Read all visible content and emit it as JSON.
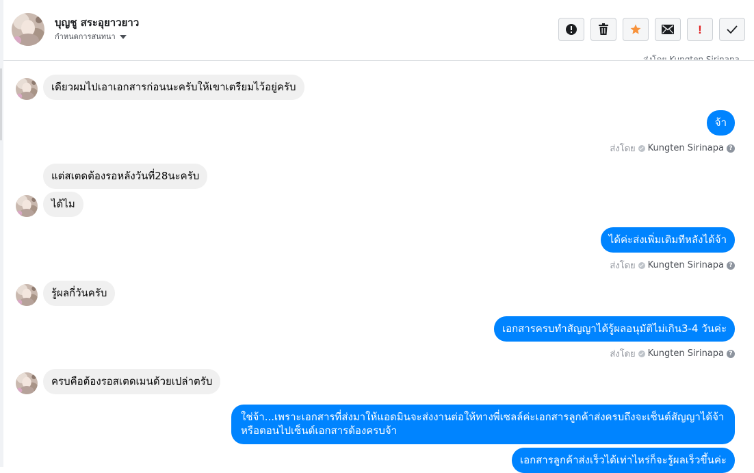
{
  "header": {
    "contact_name": "บุญชู สระอุยาวยาว",
    "subtitle": "กำหนดการสนทนา",
    "avatar_icon": "user-avatar",
    "actions": [
      {
        "name": "report-button",
        "icon": "exclamation-circle-icon"
      },
      {
        "name": "delete-button",
        "icon": "trash-icon"
      },
      {
        "name": "star-button",
        "icon": "star-icon"
      },
      {
        "name": "mark-unread-button",
        "icon": "envelope-icon"
      },
      {
        "name": "important-button",
        "icon": "exclamation-icon",
        "label": "!"
      },
      {
        "name": "done-button",
        "icon": "check-icon"
      }
    ]
  },
  "thread": {
    "cut_off_text": "ส่งโดย Kungten Sirinapa",
    "sent_by_label": "ส่งโดย",
    "agent_name": "Kungten Sirinapa",
    "help_label": "?",
    "messages": [
      {
        "dir": "in",
        "text": "เดียวผมไปเอาเอกสารก่อนนะครับให้เขาเตรียมไว้อยู่ครับ"
      },
      {
        "dir": "out",
        "text": "จ้า"
      },
      {
        "dir": "in",
        "text": "แต่สเตดต้องรอหลังวันที่28นะครับ"
      },
      {
        "dir": "in",
        "text": "ได้ไม"
      },
      {
        "dir": "out",
        "text": "ได้ค่ะส่งเพิ่มเติมทีหลังได้จ้า"
      },
      {
        "dir": "in",
        "text": "รู้ผลกี่วันครับ"
      },
      {
        "dir": "out",
        "text": "เอกสารครบทำสัญญาได้รู้ผลอนุมัติไม่เกิน3-4 วันค่ะ"
      },
      {
        "dir": "in",
        "text": "ครบคือต้องรอสเตดเมนด้วยเปล่าตรับ"
      },
      {
        "dir": "out",
        "text": "ใช่จ้า...เพราะเอกสารที่ส่งมาให้แอดมินจะส่งงานต่อให้ทางพี่เซลล์ค่ะเอกสารลูกค้าส่งครบถึงจะเซ็นต์สัญญาได้จ้าหรือตอนไปเซ็นต์เอกสารต้องครบจ้า"
      },
      {
        "dir": "out",
        "text": "เอกสารลูกค้าส่งเร็วได้เท่าไหร่ก็จะรู้ผลเร็วขึ้นค่ะ"
      }
    ]
  },
  "colors": {
    "outgoing_bubble": "#0084ff",
    "incoming_bubble": "#f0f0f0",
    "star": "#f7923b",
    "important": "#e02020"
  }
}
